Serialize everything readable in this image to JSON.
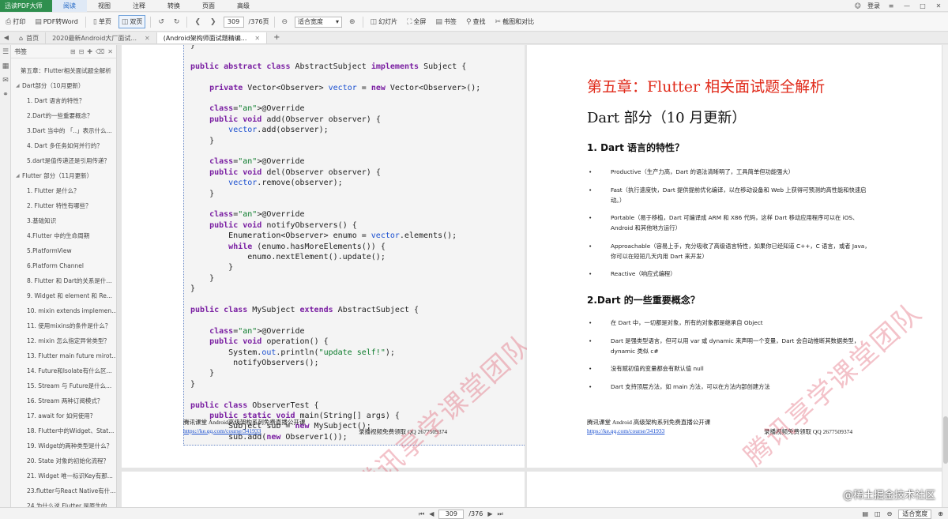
{
  "menubar": {
    "brand": "迅读PDF大师",
    "items": [
      "阅读",
      "视图",
      "注释",
      "转换",
      "页面",
      "高级"
    ],
    "active_index": 0,
    "login": "登录"
  },
  "toolbar": {
    "print": "打印",
    "to_word": "PDF转Word",
    "single_page": "单页",
    "double_page": "双页",
    "current_page": "309",
    "total_pages": "/376页",
    "zoom": "适合宽度",
    "slideshow": "幻灯片",
    "fullscreen": "全屏",
    "bookmark": "书签",
    "search": "查找",
    "screenshot": "截图和对比"
  },
  "tabs": [
    {
      "label": "首页"
    },
    {
      "label": "2020最新Android大厂面试..."
    },
    {
      "label": "(Android架构师面试题精编..."
    }
  ],
  "sidebar": {
    "title": "书签",
    "items": [
      {
        "label": "第五章：Flutter相关面试题全解析",
        "level": 0
      },
      {
        "label": "Dart部分（10月更新）",
        "level": 1
      },
      {
        "label": "1. Dart 语言的特性？",
        "level": 2
      },
      {
        "label": "2.Dart的一些重要概念？",
        "level": 2
      },
      {
        "label": "3.Dart 当中的 「..」表示什么...",
        "level": 2
      },
      {
        "label": "4. Dart 多任务如何并行的？",
        "level": 2
      },
      {
        "label": "5.dart是值传递还是引用传递？",
        "level": 2
      },
      {
        "label": "Flutter 部分（11月更新）",
        "level": 1
      },
      {
        "label": "1. Flutter 是什么？",
        "level": 2
      },
      {
        "label": "2. Flutter 特性有哪些？",
        "level": 2
      },
      {
        "label": "3.基础知识",
        "level": 2
      },
      {
        "label": "4.Flutter 中的生命周期",
        "level": 2
      },
      {
        "label": "5.PlatformView",
        "level": 2
      },
      {
        "label": "6.Platform Channel",
        "level": 2
      },
      {
        "label": "8. Flutter 和 Dart的关系是什...",
        "level": 2
      },
      {
        "label": "9. Widget 和 element 和 Re...",
        "level": 2
      },
      {
        "label": "10. mixin extends implemen...",
        "level": 2
      },
      {
        "label": "11. 使用mixins的条件是什么？",
        "level": 2
      },
      {
        "label": "12. mixin 怎么指定异常类型？",
        "level": 2
      },
      {
        "label": "13. Flutter main future mirot...",
        "level": 2
      },
      {
        "label": "14. Future和Isolate有什么区...",
        "level": 2
      },
      {
        "label": "15. Stream 与 Future是什么...",
        "level": 2
      },
      {
        "label": "16. Stream 两种订阅模式？",
        "level": 2
      },
      {
        "label": "17. await for 如何使用?",
        "level": 2
      },
      {
        "label": "18. Flutter中的Widget、Stat...",
        "level": 2
      },
      {
        "label": "19. Widget的两种类型是什么？",
        "level": 2
      },
      {
        "label": "20. State 对象的初始化流程？",
        "level": 2
      },
      {
        "label": "21. Widget 唯一标识Key有那...",
        "level": 2
      },
      {
        "label": "23.flutter与React Native有什...",
        "level": 2
      },
      {
        "label": "24.为什么说 Flutter 是原生的...",
        "level": 2
      }
    ]
  },
  "left_page": {
    "code": [
      "}",
      "",
      "public abstract class AbstractSubject implements Subject {",
      "",
      "    private Vector<Observer> vector = new Vector<Observer>();",
      "",
      "    @Override",
      "    public void add(Observer observer) {",
      "        vector.add(observer);",
      "    }",
      "",
      "    @Override",
      "    public void del(Observer observer) {",
      "        vector.remove(observer);",
      "    }",
      "",
      "    @Override",
      "    public void notifyObservers() {",
      "        Enumeration<Observer> enumo = vector.elements();",
      "        while (enumo.hasMoreElements()) {",
      "            enumo.nextElement().update();",
      "        }",
      "    }",
      "}",
      "",
      "public class MySubject extends AbstractSubject {",
      "",
      "    @Override",
      "    public void operation() {",
      "        System.out.println(\"update self!\");",
      "         notifyObservers();",
      "    }",
      "}",
      "",
      "public class ObserverTest {",
      "    public static void main(String[] args) {",
      "        Subject sub = new MySubject();",
      "        sub.add(new Observer1());"
    ],
    "footer_text": "腾讯课堂 Android高级架构系列免费直播公开课",
    "footer_link": "https://ke.qq.com/course/341933",
    "footer_qq": "录播视频免费领取 QQ  2677509374",
    "watermark": "腾讯享学课堂团队"
  },
  "right_page": {
    "chapter_title": "第五章：Flutter 相关面试题全解析",
    "dart_heading": "Dart 部分（10 月更新）",
    "sec1_title": "1. Dart 语言的特性？",
    "sec1_bullets": [
      "Productive（生产力高，Dart 的语法清晰明了，工具简单但功能强大）",
      "Fast（执行速度快，Dart 提供提前优化编译，以在移动设备和 Web 上获得可预测的高性能和快速启动。）",
      "Portable（易于移植，Dart 可编译成 ARM 和 X86 代码，这样 Dart 移动应用程序可以在 iOS、Android 和其他地方运行）",
      "Approachable（容易上手，充分吸收了高级语言特性，如果你已经知道 C++，C 语言，或者 Java，你可以在短短几天内用 Dart 来开发）",
      "Reactive（响应式编程）"
    ],
    "sec2_title": "2.Dart 的一些重要概念？",
    "sec2_bullets": [
      "在 Dart 中，一切都是对象，所有的对象都是继承自 Object",
      "Dart 是强类型语言，但可以用 var 或 dynamic 来声明一个变量，Dart 会自动推断其数据类型，dynamic 类似 c#",
      "没有赋初值的变量都会有默认值 null",
      "Dart 支持顶层方法，如 main 方法，可以在方法内部创建方法"
    ],
    "footer_text": "腾讯课堂 Android 高级架构系列免费直播公开课",
    "footer_link": "https://ke.qq.com/course/341933",
    "footer_qq": "录播视频免费领取 QQ   2677509374",
    "watermark": "腾讯享学课堂团队"
  },
  "statusbar": {
    "current_page": "309",
    "total_pages": "/376",
    "zoom": "适合宽度"
  },
  "credit": "@稀土掘金技术社区"
}
